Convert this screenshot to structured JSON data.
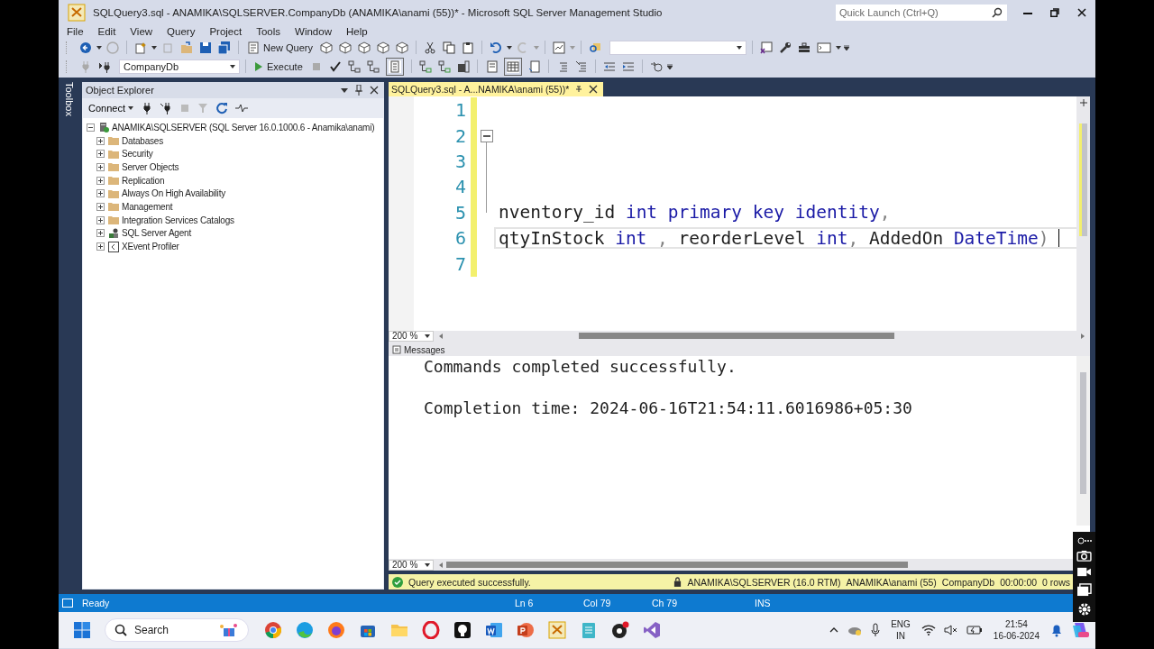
{
  "window": {
    "title": "SQLQuery3.sql - ANAMIKA\\SQLSERVER.CompanyDb (ANAMIKA\\anami (55))* - Microsoft SQL Server Management Studio"
  },
  "quick_launch": {
    "placeholder": "Quick Launch (Ctrl+Q)"
  },
  "menu": [
    "File",
    "Edit",
    "View",
    "Query",
    "Project",
    "Tools",
    "Window",
    "Help"
  ],
  "toolbar": {
    "new_query": "New Query",
    "database": "CompanyDb",
    "execute": "Execute"
  },
  "toolbox_tab": "Toolbox",
  "object_explorer": {
    "title": "Object Explorer",
    "connect": "Connect",
    "tree": [
      {
        "label": "ANAMIKA\\SQLSERVER (SQL Server 16.0.1000.6 - Anamika\\anami)",
        "kind": "server",
        "expanded": true,
        "children": [
          {
            "label": "Databases",
            "kind": "folder",
            "expanded": false
          },
          {
            "label": "Security",
            "kind": "folder",
            "expanded": false
          },
          {
            "label": "Server Objects",
            "kind": "folder",
            "expanded": false
          },
          {
            "label": "Replication",
            "kind": "folder",
            "expanded": false
          },
          {
            "label": "Always On High Availability",
            "kind": "folder",
            "expanded": false
          },
          {
            "label": "Management",
            "kind": "folder",
            "expanded": false
          },
          {
            "label": "Integration Services Catalogs",
            "kind": "folder",
            "expanded": false
          },
          {
            "label": "SQL Server Agent",
            "kind": "agent",
            "expanded": false
          },
          {
            "label": "XEvent Profiler",
            "kind": "profiler",
            "expanded": false
          }
        ]
      }
    ]
  },
  "editor": {
    "tab": {
      "label": "SQLQuery3.sql - A...NAMIKA\\anami (55))*",
      "selected": true
    },
    "zoom": "200 %",
    "lines": [
      {
        "number": "1",
        "fold": false,
        "current": false
      },
      {
        "number": "2",
        "fold": true,
        "current": false
      },
      {
        "number": "3",
        "fold": false,
        "current": false
      },
      {
        "number": "4",
        "fold": false,
        "current": false
      },
      {
        "number": "5",
        "fold": false,
        "current": false,
        "tokens": [
          {
            "text": "nventory_id ",
            "kind": "plain"
          },
          {
            "text": "int primary key identity",
            "kind": "keyword"
          },
          {
            "text": ",",
            "kind": "punct"
          }
        ]
      },
      {
        "number": "6",
        "fold": false,
        "current": true,
        "tokens": [
          {
            "text": "qtyInStock ",
            "kind": "plain"
          },
          {
            "text": "int",
            "kind": "keyword"
          },
          {
            "text": " , ",
            "kind": "punct"
          },
          {
            "text": "reorderLevel ",
            "kind": "plain"
          },
          {
            "text": "int",
            "kind": "keyword"
          },
          {
            "text": ", ",
            "kind": "punct"
          },
          {
            "text": "AddedOn ",
            "kind": "plain"
          },
          {
            "text": "DateTime",
            "kind": "keyword"
          },
          {
            "text": ")",
            "kind": "punct"
          }
        ]
      },
      {
        "number": "7",
        "fold": false,
        "current": false
      }
    ]
  },
  "results": {
    "tab": "Messages",
    "zoom": "200 %",
    "messages": [
      "Commands completed successfully.",
      "Completion time: 2024-06-16T21:54:11.6016986+05:30"
    ],
    "status": {
      "text": "Query executed successfully.",
      "server": "ANAMIKA\\SQLSERVER (16.0 RTM)",
      "user": "ANAMIKA\\anami (55)",
      "database": "CompanyDb",
      "elapsed": "00:00:00",
      "rows": "0 rows"
    }
  },
  "status_bar": {
    "state": "Ready",
    "line": "Ln 6",
    "column": "Col 79",
    "char": "Ch 79",
    "mode": "INS"
  },
  "taskbar": {
    "search": {
      "placeholder": "Search"
    },
    "language": "ENG",
    "region": "IN",
    "time": "21:54",
    "date": "16-06-2024"
  }
}
